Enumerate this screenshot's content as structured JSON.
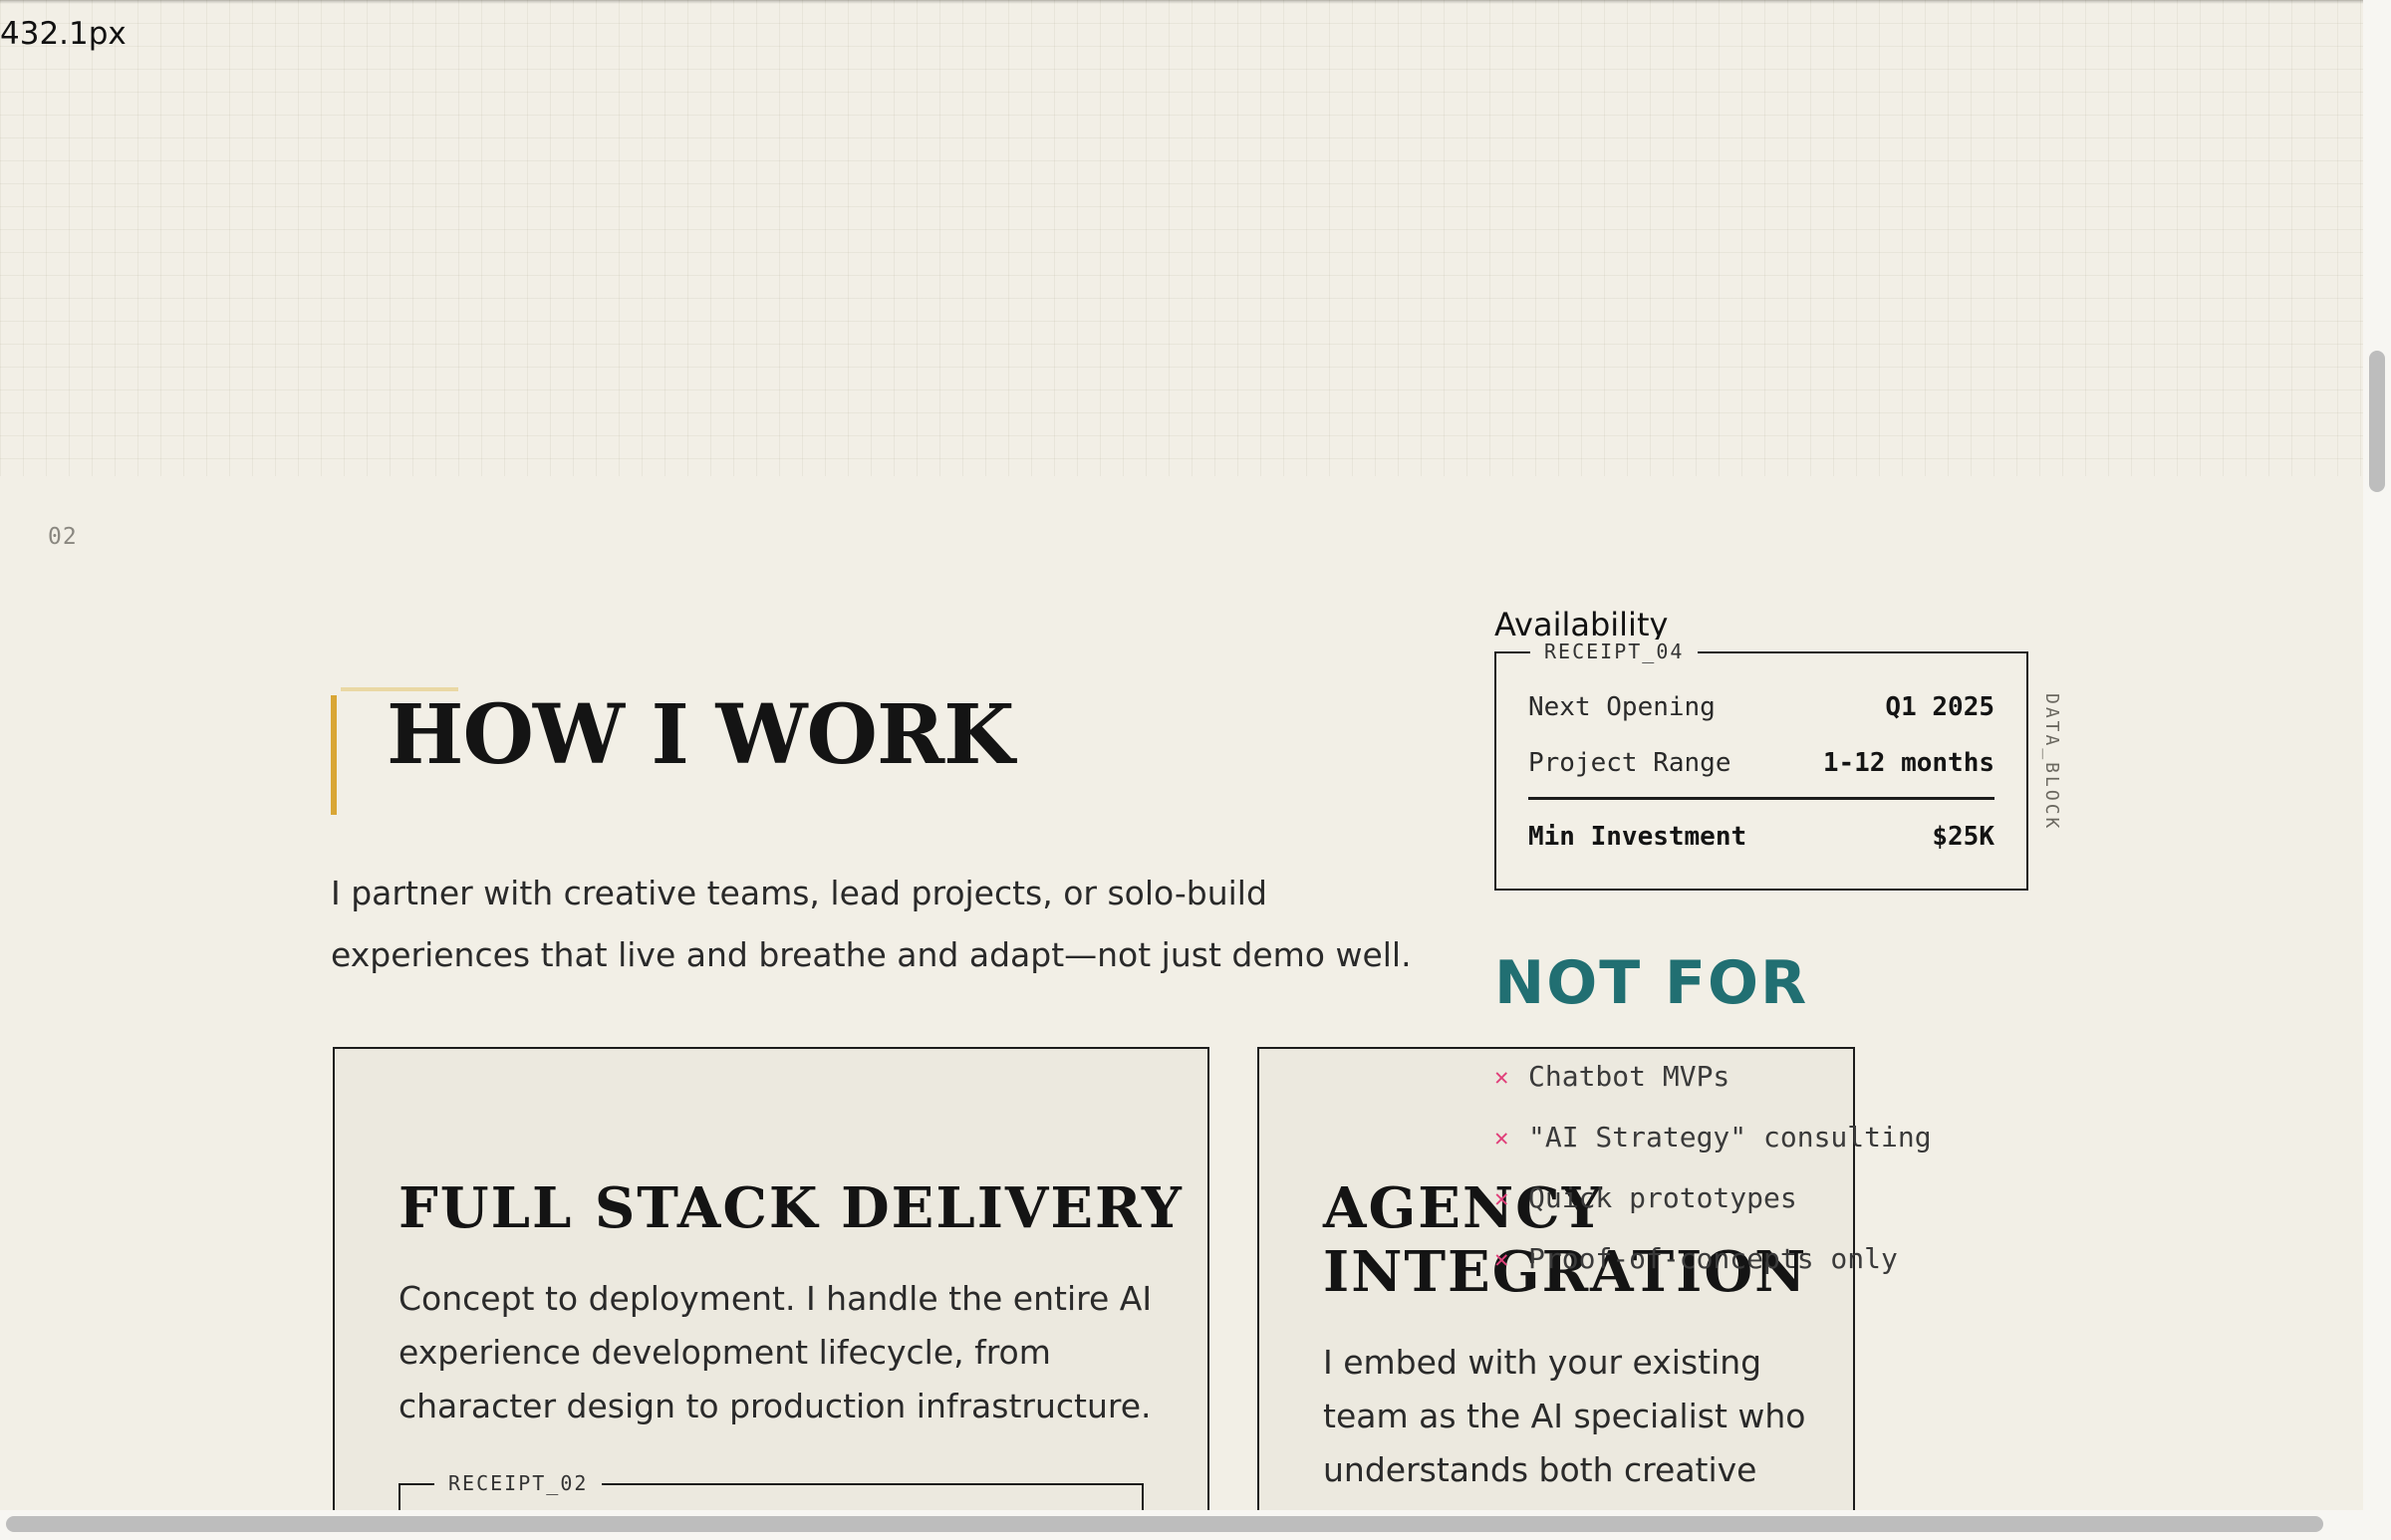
{
  "readout": {
    "px_text": "432.1px"
  },
  "section": {
    "number": "02"
  },
  "heading": {
    "title": "HOW I WORK"
  },
  "intro": {
    "text": "I partner with creative teams, lead projects, or solo-build experiences that live and breathe and adapt—not just demo well."
  },
  "cards": [
    {
      "title": "FULL STACK DELIVERY",
      "body": "Concept to deployment. I handle the entire AI experience development lifecycle, from character design to production infrastructure.",
      "receipt_tag": "RECEIPT_02"
    },
    {
      "title": "AGENCY INTEGRATION",
      "body": "I embed with your existing team as the AI specialist who understands both creative"
    }
  ],
  "availability": {
    "label": "Availability",
    "receipt_tag": "RECEIPT_04",
    "rows": [
      {
        "label": "Next Opening",
        "value": "Q1 2025"
      },
      {
        "label": "Project Range",
        "value": "1-12 months"
      }
    ],
    "total": {
      "label": "Min Investment",
      "value": "$25K"
    },
    "side_label": "DATA_BLOCK"
  },
  "not_for": {
    "title": "NOT FOR",
    "items": [
      "Chatbot MVPs",
      "\"AI Strategy\" consulting",
      "Quick prototypes",
      "Proof-of-concepts only"
    ],
    "icon": "x-icon",
    "icon_color": "#e0407a"
  },
  "colors": {
    "accent_gold": "#d9a635",
    "accent_teal": "#216f72",
    "background": "#f2efe6"
  }
}
